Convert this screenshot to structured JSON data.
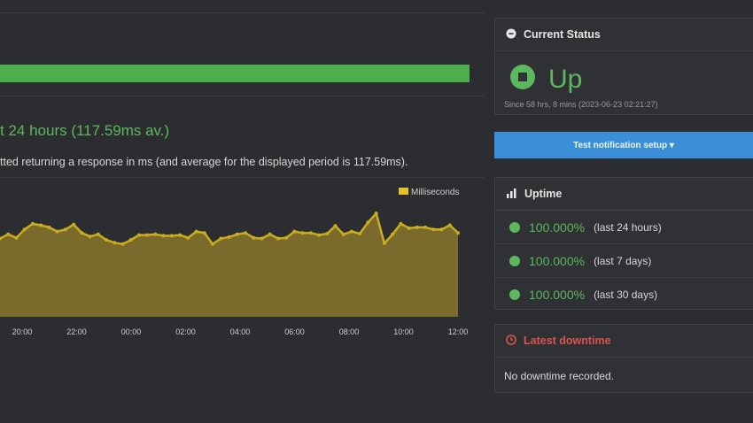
{
  "left": {
    "response_title": "t 24 hours (117.59ms av.)",
    "response_desc": "tted returning a response in ms (and average for the displayed period is 117.59ms)."
  },
  "chart_data": {
    "type": "area",
    "series": [
      {
        "name": "Milliseconds",
        "values": [
          112,
          118,
          113,
          125,
          133,
          131,
          128,
          122,
          125,
          132,
          120,
          115,
          118,
          110,
          106,
          104,
          110,
          117,
          117,
          118,
          116,
          116,
          117,
          113,
          122,
          120,
          104,
          112,
          114,
          118,
          120,
          113,
          112,
          118,
          112,
          113,
          122,
          120,
          120,
          117,
          119,
          130,
          118,
          122,
          119,
          135,
          148,
          105,
          118,
          133,
          127,
          128,
          128,
          125,
          125,
          131,
          120
        ]
      }
    ],
    "x_tick_labels": [
      "20:00",
      "22:00",
      "00:00",
      "02:00",
      "04:00",
      "06:00",
      "08:00",
      "10:00",
      "12:00"
    ],
    "legend_label": "Milliseconds",
    "legend_position": "top-right",
    "y_range": [
      0,
      200
    ],
    "fill_color": "#7a6b2c",
    "line_color": "#c9ad1e"
  },
  "status": {
    "header": "Current Status",
    "state": "Up",
    "since": "Since 58 hrs, 8 mins (2023-06-23 02:21:27)",
    "color": "#5cb85c"
  },
  "notify": {
    "label": "Test notification setup ▾",
    "color": "#3a8fd8"
  },
  "uptime": {
    "header": "Uptime",
    "rows": [
      {
        "pct": "100.000%",
        "period": "(last 24 hours)"
      },
      {
        "pct": "100.000%",
        "period": "(last 7 days)"
      },
      {
        "pct": "100.000%",
        "period": "(last 30 days)"
      }
    ]
  },
  "downtime": {
    "header": "Latest downtime",
    "text": "No downtime recorded.",
    "color": "#d9534f"
  }
}
